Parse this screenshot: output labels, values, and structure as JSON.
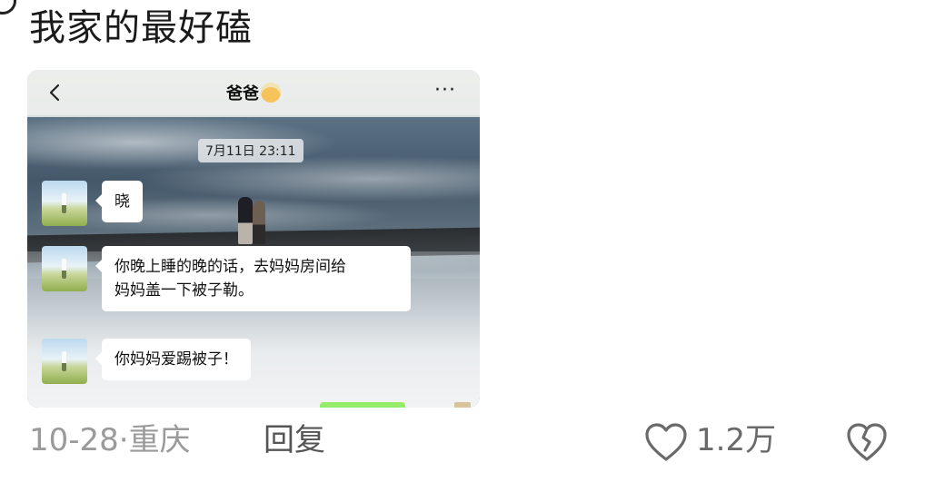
{
  "comment": {
    "text": "我家的最好磕",
    "date": "10-28·",
    "location": "重庆",
    "reply_label": "回复",
    "like_count": "1.2万"
  },
  "chat_screenshot": {
    "title": "爸爸",
    "timestamp": "7月11日 23:11",
    "messages": [
      {
        "text": "晓"
      },
      {
        "text": "你晚上睡的晚的话，去妈妈房间给\n妈妈盖一下被子勒。"
      },
      {
        "text": "你妈妈爱踢被子！"
      }
    ]
  },
  "icons": {
    "back": "chevron-left-icon",
    "more": "more-dots-icon",
    "like": "heart-outline-icon",
    "dislike": "broken-heart-icon"
  },
  "colors": {
    "chat_bubble_right": "#95ec69",
    "meta_gray": "#9a9a9a"
  }
}
